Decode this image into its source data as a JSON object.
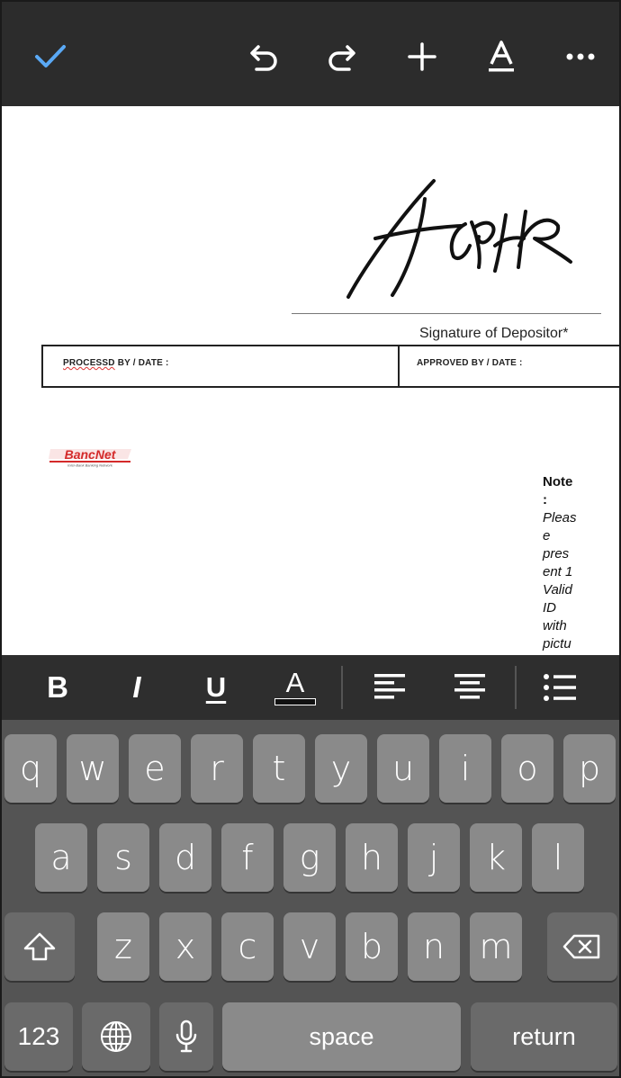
{
  "toolbar": {
    "icons": [
      "check-icon",
      "undo-icon",
      "redo-icon",
      "plus-icon",
      "text-format-icon",
      "more-icon"
    ],
    "accent_color": "#5aa9f5"
  },
  "document": {
    "signature_label": "Signature of Depositor*",
    "processed_label_prefix": "PROCESSD",
    "processed_label_rest": " BY / DATE :",
    "approved_label": "APPROVED BY / DATE :",
    "logo_text": "BancNet",
    "logo_subtext": "Inter-Bank Banking Network",
    "note_heading_lines": [
      "Note",
      ":"
    ],
    "note_body_lines": [
      "Pleas",
      "e",
      "pres",
      "ent 1",
      "Valid",
      "ID",
      "with",
      "pictu"
    ]
  },
  "format_bar": {
    "bold_label": "B",
    "italic_label": "I",
    "underline_label": "U",
    "text_color_label": "A"
  },
  "keyboard": {
    "row1": [
      "q",
      "w",
      "e",
      "r",
      "t",
      "y",
      "u",
      "i",
      "o",
      "p"
    ],
    "row2": [
      "a",
      "s",
      "d",
      "f",
      "g",
      "h",
      "j",
      "k",
      "l"
    ],
    "row3": [
      "z",
      "x",
      "c",
      "v",
      "b",
      "n",
      "m"
    ],
    "numbers_label": "123",
    "space_label": "space",
    "return_label": "return"
  }
}
